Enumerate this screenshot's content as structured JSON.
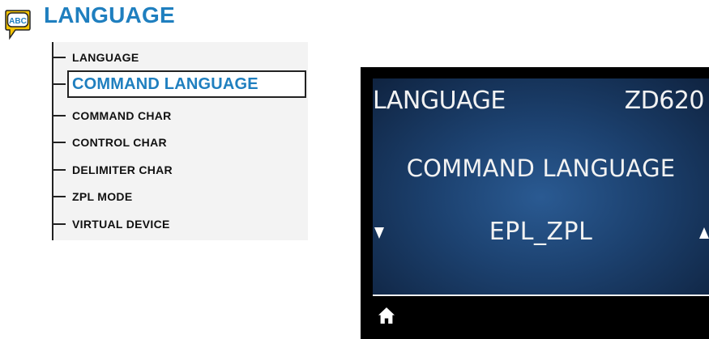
{
  "header": {
    "icon": "abc-speech-bubble-icon",
    "icon_text": "ABC",
    "title": "LANGUAGE"
  },
  "menu_tree": {
    "items": [
      {
        "label": "LANGUAGE",
        "selected": false
      },
      {
        "label": "COMMAND LANGUAGE",
        "selected": true
      },
      {
        "label": "COMMAND CHAR",
        "selected": false
      },
      {
        "label": "CONTROL CHAR",
        "selected": false
      },
      {
        "label": "DELIMITER CHAR",
        "selected": false
      },
      {
        "label": "ZPL MODE",
        "selected": false
      },
      {
        "label": "VIRTUAL DEVICE",
        "selected": false
      }
    ]
  },
  "display": {
    "menu_title": "LANGUAGE",
    "model": "ZD620",
    "item_name": "COMMAND LANGUAGE",
    "value": "EPL_ZPL",
    "left_arrow": "down-triangle-icon",
    "right_arrow": "up-triangle-icon",
    "home": "home-icon"
  },
  "colors": {
    "title_blue": "#1f7fbf",
    "icon_yellow": "#f5c400",
    "screen_blue": "#1c416f",
    "screen_black": "#000000"
  }
}
